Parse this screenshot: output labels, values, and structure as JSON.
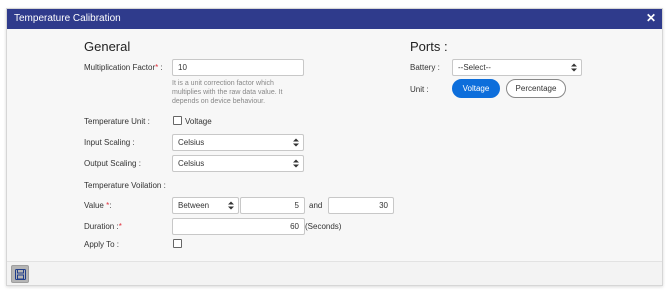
{
  "dialog": {
    "title": "Temperature Calibration",
    "close_glyph": "✕"
  },
  "general": {
    "heading": "General",
    "multiplication_factor": {
      "label": "Multiplication Factor",
      "required_mark": "*",
      "suffix": " :",
      "value": "10",
      "help": "It is a unit correction factor which multiplies with the raw data value. It depends on device behaviour."
    },
    "temperature_unit": {
      "label": "Temperature Unit :",
      "checkbox_label": "Voltage",
      "checked": false
    },
    "input_scaling": {
      "label": "Input Scaling :",
      "selected": "Celsius"
    },
    "output_scaling": {
      "label": "Output Scaling :",
      "selected": "Celsius"
    },
    "temperature_violation": {
      "label": "Temperature Voilation :"
    },
    "value": {
      "label": "Value",
      "required_mark": "*",
      "suffix": ":",
      "operator": "Between",
      "min": "5",
      "connector": "and",
      "max": "30"
    },
    "duration": {
      "label": "Duration",
      "suffix": ":",
      "required_mark": "*",
      "value": "60",
      "unit": "(Seconds)"
    },
    "apply_to": {
      "label": "Apply To :",
      "checked": false
    }
  },
  "ports": {
    "heading": "Ports :",
    "battery": {
      "label": "Battery :",
      "selected": "--Select--"
    },
    "unit": {
      "label": "Unit :",
      "options": [
        "Voltage",
        "Percentage"
      ],
      "active": "Voltage"
    }
  },
  "footer": {
    "save_icon": "save-icon"
  },
  "colors": {
    "titlebar": "#2f3b8c",
    "accent": "#0d6edb",
    "required": "#e0303c"
  }
}
